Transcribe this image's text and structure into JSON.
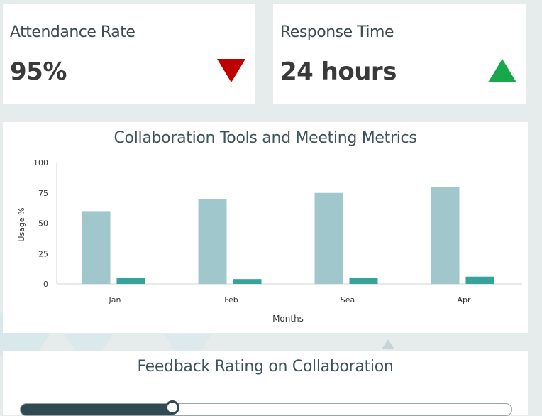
{
  "kpis": [
    {
      "label": "Attendance Rate",
      "value": "95%",
      "trend": "down",
      "trend_color": "#c00000",
      "icon": "triangle-down-icon"
    },
    {
      "label": "Response Time",
      "value": "24 hours",
      "trend": "up",
      "trend_color": "#17a84b",
      "icon": "triangle-up-icon"
    }
  ],
  "chart_data": {
    "type": "bar",
    "title": "Collaboration Tools and Meeting Metrics",
    "xlabel": "Months",
    "ylabel": "Usage %",
    "categories": [
      "Jan",
      "Feb",
      "Sea",
      "Apr"
    ],
    "series": [
      {
        "values": [
          60,
          70,
          75,
          80
        ],
        "color": "#a0c8cc"
      },
      {
        "values": [
          5,
          4,
          5,
          6
        ],
        "color": "#35a39c"
      }
    ],
    "ylim": [
      0,
      100
    ],
    "yticks": [
      0,
      25,
      50,
      75,
      100
    ],
    "grid": false
  },
  "feedback": {
    "title": "Feedback Rating on Collaboration",
    "level_fraction": 0.31,
    "fill_color": "#2f4a50"
  }
}
